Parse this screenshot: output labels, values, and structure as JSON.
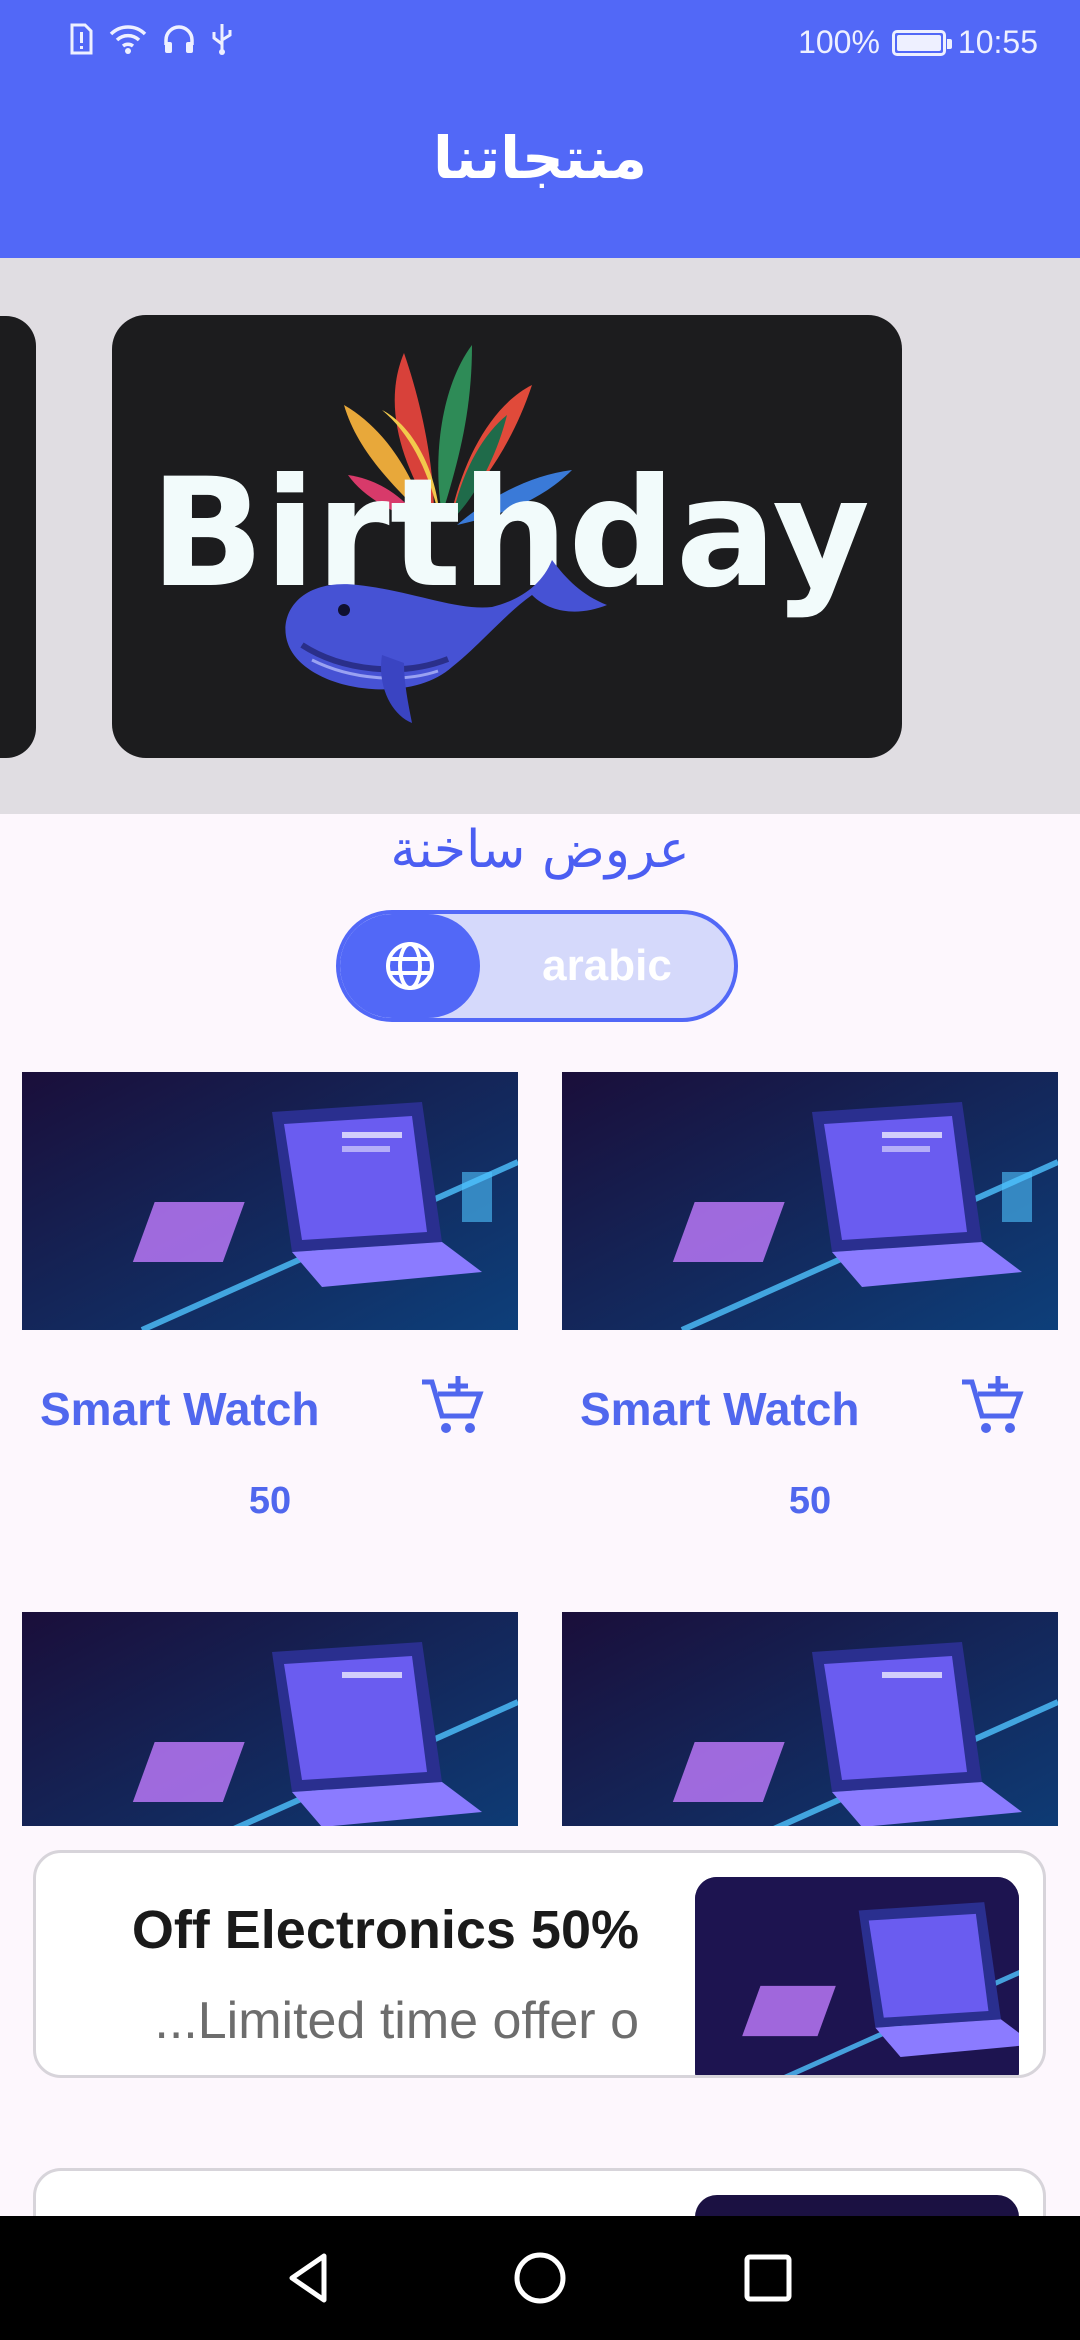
{
  "status_bar": {
    "battery_percent": "100%",
    "battery_level": 1.0,
    "time": "10:55",
    "icons": [
      "sim-alert-icon",
      "wifi-icon",
      "headphones-icon",
      "usb-icon"
    ]
  },
  "app_bar": {
    "title": "منتجاتنا"
  },
  "carousel": {
    "banner_text": "Birthday"
  },
  "offers_section": {
    "title": "عروض ساخنة"
  },
  "language_toggle": {
    "label": "arabic",
    "icon": "globe-icon"
  },
  "products": [
    {
      "name": "Smart Watch",
      "price": "50"
    },
    {
      "name": "Smart Watch",
      "price": "50"
    },
    {
      "name": "",
      "price": ""
    },
    {
      "name": "",
      "price": ""
    }
  ],
  "offers": [
    {
      "title": "Off Electronics 50%",
      "subtitle": "...Limited time offer o"
    },
    {
      "title": "",
      "subtitle": ""
    }
  ],
  "colors": {
    "primary": "#5268f7",
    "accent_text": "#5067ee",
    "carousel_bg": "#e0dde2",
    "page_bg": "#fdf7fd"
  },
  "nav_bar": {
    "icons": [
      "back-icon",
      "home-icon",
      "recents-icon"
    ]
  }
}
